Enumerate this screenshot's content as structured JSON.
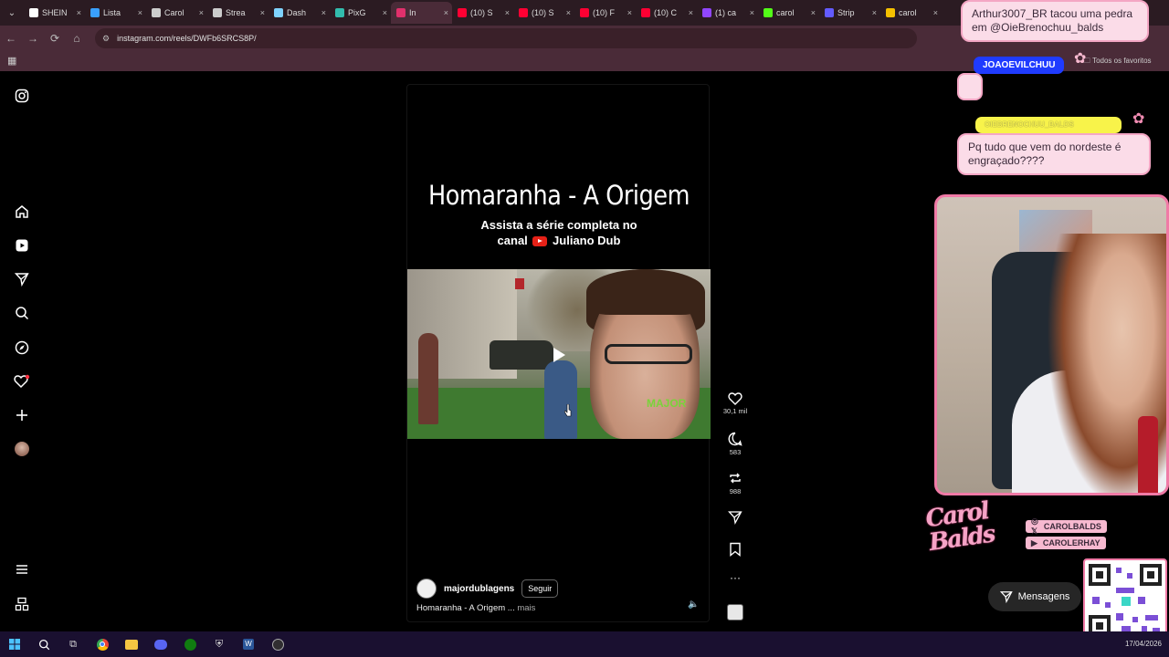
{
  "browser": {
    "tabs": [
      {
        "label": "SHEIN",
        "color": "#ffffff"
      },
      {
        "label": "Lista",
        "color": "#3aa0ff"
      },
      {
        "label": "Carol",
        "color": "#cccccc"
      },
      {
        "label": "Strea",
        "color": "#cccccc"
      },
      {
        "label": "Dash",
        "color": "#7fd3ff"
      },
      {
        "label": "PixG",
        "color": "#32bcad"
      },
      {
        "label": "In",
        "color": "#e1306c",
        "active": true
      },
      {
        "label": "(10) S",
        "color": "#ff0033"
      },
      {
        "label": "(10) S",
        "color": "#ff0033"
      },
      {
        "label": "(10) F",
        "color": "#ff0033"
      },
      {
        "label": "(10) C",
        "color": "#ff0033"
      },
      {
        "label": "(1) ca",
        "color": "#9146ff"
      },
      {
        "label": "carol",
        "color": "#53fc18"
      },
      {
        "label": "Strip",
        "color": "#635bff"
      },
      {
        "label": "carol",
        "color": "#f5c000"
      }
    ],
    "url": "instagram.com/reels/DWFb6SRCS8P/",
    "bookmarks_label": "Todos os favoritos"
  },
  "reel": {
    "title": "Homaranha - A Origem",
    "subtitle_line1": "Assista a série completa no",
    "subtitle_prefix": "canal",
    "subtitle_channel": "Juliano Dub",
    "watermark": "MAJOR",
    "author": "majordublagens",
    "follow_label": "Seguir",
    "caption": "Homaranha - A Origem ...",
    "caption_more": "mais"
  },
  "actions": {
    "likes": "30,1 mil",
    "comments": "583",
    "reposts": "988"
  },
  "stream_overlay": {
    "chat": [
      {
        "text": "Arthur3007_BR tacou uma pedra em @OieBrenochuu_balds"
      },
      {
        "name": "JOAOEVILCHUU"
      },
      {
        "name": "OIEBRENOCHUU_BALDS",
        "text": "Pq tudo que vem do nordeste é engraçado????"
      }
    ],
    "brand": "Carol Balds",
    "handles": [
      "CAROLBALDS",
      "CAROLERHAY"
    ]
  },
  "messages_label": "Mensagens",
  "taskbar": {
    "date": "17/04/2026"
  }
}
